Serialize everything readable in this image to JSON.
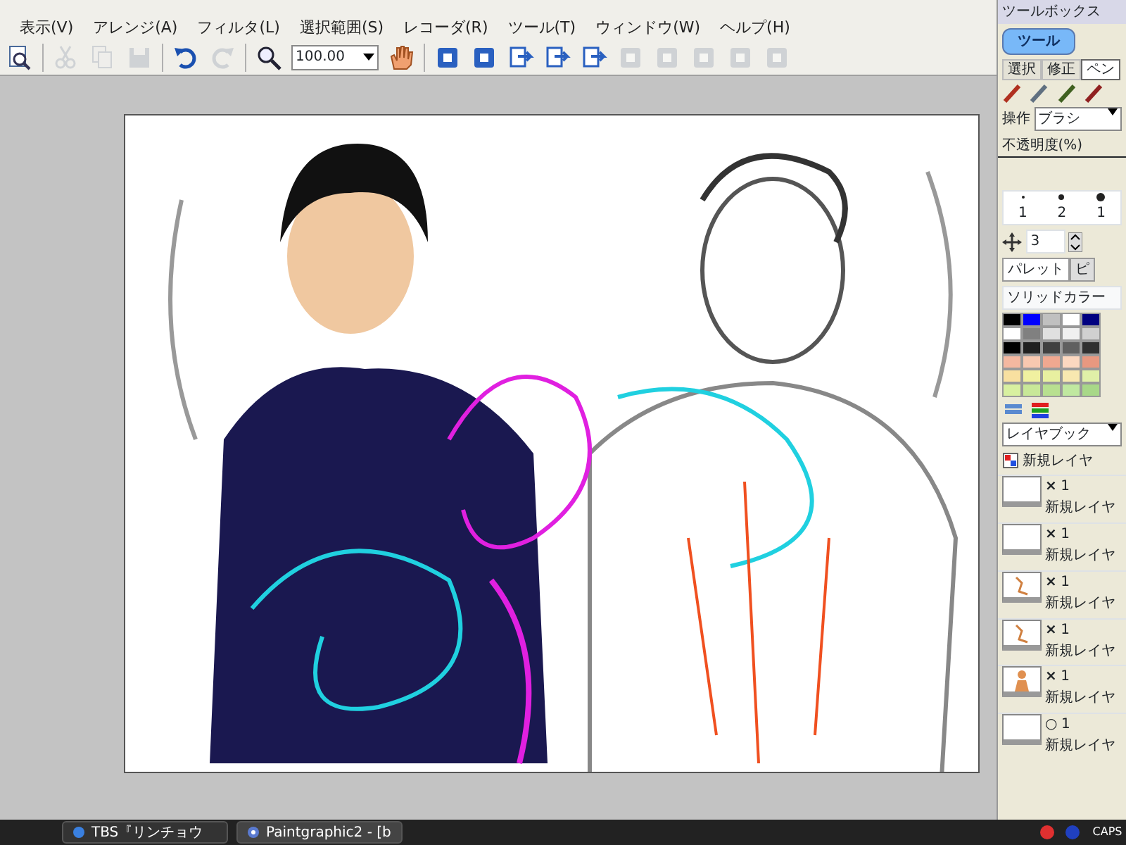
{
  "menu": [
    {
      "label": "表示(V)"
    },
    {
      "label": "アレンジ(A)"
    },
    {
      "label": "フィルタ(L)"
    },
    {
      "label": "選択範囲(S)"
    },
    {
      "label": "レコーダ(R)"
    },
    {
      "label": "ツール(T)"
    },
    {
      "label": "ウィンドウ(W)"
    },
    {
      "label": "ヘルプ(H)"
    }
  ],
  "toolbar": {
    "buttons": [
      {
        "kind": "preview",
        "disabled": false
      },
      {
        "kind": "cut",
        "disabled": true
      },
      {
        "kind": "copy",
        "disabled": true
      },
      {
        "kind": "save",
        "disabled": true
      },
      {
        "kind": "undo",
        "disabled": false
      },
      {
        "kind": "redo",
        "disabled": true
      },
      {
        "kind": "zoom",
        "disabled": false
      }
    ],
    "zoom": "100.00",
    "tools": [
      {
        "kind": "hand",
        "disabled": false
      },
      {
        "kind": "box",
        "disabled": false
      },
      {
        "kind": "box",
        "disabled": false
      },
      {
        "kind": "arrow",
        "disabled": false
      },
      {
        "kind": "arrow",
        "disabled": false
      },
      {
        "kind": "arrow",
        "disabled": false
      },
      {
        "kind": "box",
        "disabled": true
      },
      {
        "kind": "box",
        "disabled": true
      },
      {
        "kind": "box",
        "disabled": true
      },
      {
        "kind": "box",
        "disabled": true
      },
      {
        "kind": "box",
        "disabled": true
      }
    ]
  },
  "toolbox": {
    "title": "ツールボックス",
    "tabs": [
      {
        "label": "ツール",
        "selected": true
      }
    ],
    "tools": [
      {
        "label": "選択",
        "selected": false
      },
      {
        "label": "修正",
        "selected": false
      },
      {
        "label": "ペン",
        "selected": true
      }
    ],
    "operation": {
      "label": "操作",
      "value": "ブラシ"
    },
    "opacity_label": "不透明度(%)",
    "brush_sizes": [
      "1",
      "2",
      "1"
    ],
    "size": "3"
  },
  "palette": {
    "tabs": [
      {
        "label": "パレット",
        "selected": true
      },
      {
        "label": "ピ",
        "selected": false
      }
    ],
    "set": "ソリッドカラー",
    "swatches": [
      {
        "color": "#000000"
      },
      {
        "color": "#0000ff"
      },
      {
        "color": "#c0c0c0"
      },
      {
        "color": "#ffffff"
      },
      {
        "color": "#000080"
      },
      {
        "color": "#ffffff"
      },
      {
        "color": "#808080"
      },
      {
        "color": "#e0e0e0"
      },
      {
        "color": "#f0f0f0"
      },
      {
        "color": "#d0d0d0"
      },
      {
        "color": "#000000"
      },
      {
        "color": "#202020"
      },
      {
        "color": "#404040"
      },
      {
        "color": "#606060"
      },
      {
        "color": "#303030"
      },
      {
        "color": "#f4b8a0"
      },
      {
        "color": "#f8c8b0"
      },
      {
        "color": "#f0a890"
      },
      {
        "color": "#fcd8c0"
      },
      {
        "color": "#e89880"
      },
      {
        "color": "#f8e0a0"
      },
      {
        "color": "#f0f0a0"
      },
      {
        "color": "#e8f0a0"
      },
      {
        "color": "#f8e8b0"
      },
      {
        "color": "#e0f0a8"
      },
      {
        "color": "#d8f0a0"
      },
      {
        "color": "#c8e898"
      },
      {
        "color": "#b8e090"
      },
      {
        "color": "#c0e8a0"
      },
      {
        "color": "#a8d888"
      }
    ]
  },
  "layers": {
    "book": "レイヤブック",
    "new_button": "新規レイヤ",
    "rows": [
      {
        "mark": "×",
        "name": "新規レイヤ",
        "number": "1",
        "kind": "blank"
      },
      {
        "mark": "×",
        "name": "新規レイヤ",
        "number": "1",
        "kind": "blank"
      },
      {
        "mark": "×",
        "name": "新規レイヤ",
        "number": "1",
        "kind": "sketch"
      },
      {
        "mark": "×",
        "name": "新規レイヤ",
        "number": "1",
        "kind": "sketch"
      },
      {
        "mark": "×",
        "name": "新規レイヤ",
        "number": "1",
        "kind": "figure"
      },
      {
        "mark": "○",
        "name": "新規レイヤ",
        "number": "1",
        "kind": "blank"
      }
    ]
  },
  "taskbar": {
    "tasks": [
      {
        "label": "TBS『リンチョウ",
        "selected": false
      },
      {
        "label": "Paintgraphic2 - [b",
        "selected": true
      }
    ],
    "tray": "CAPS"
  }
}
